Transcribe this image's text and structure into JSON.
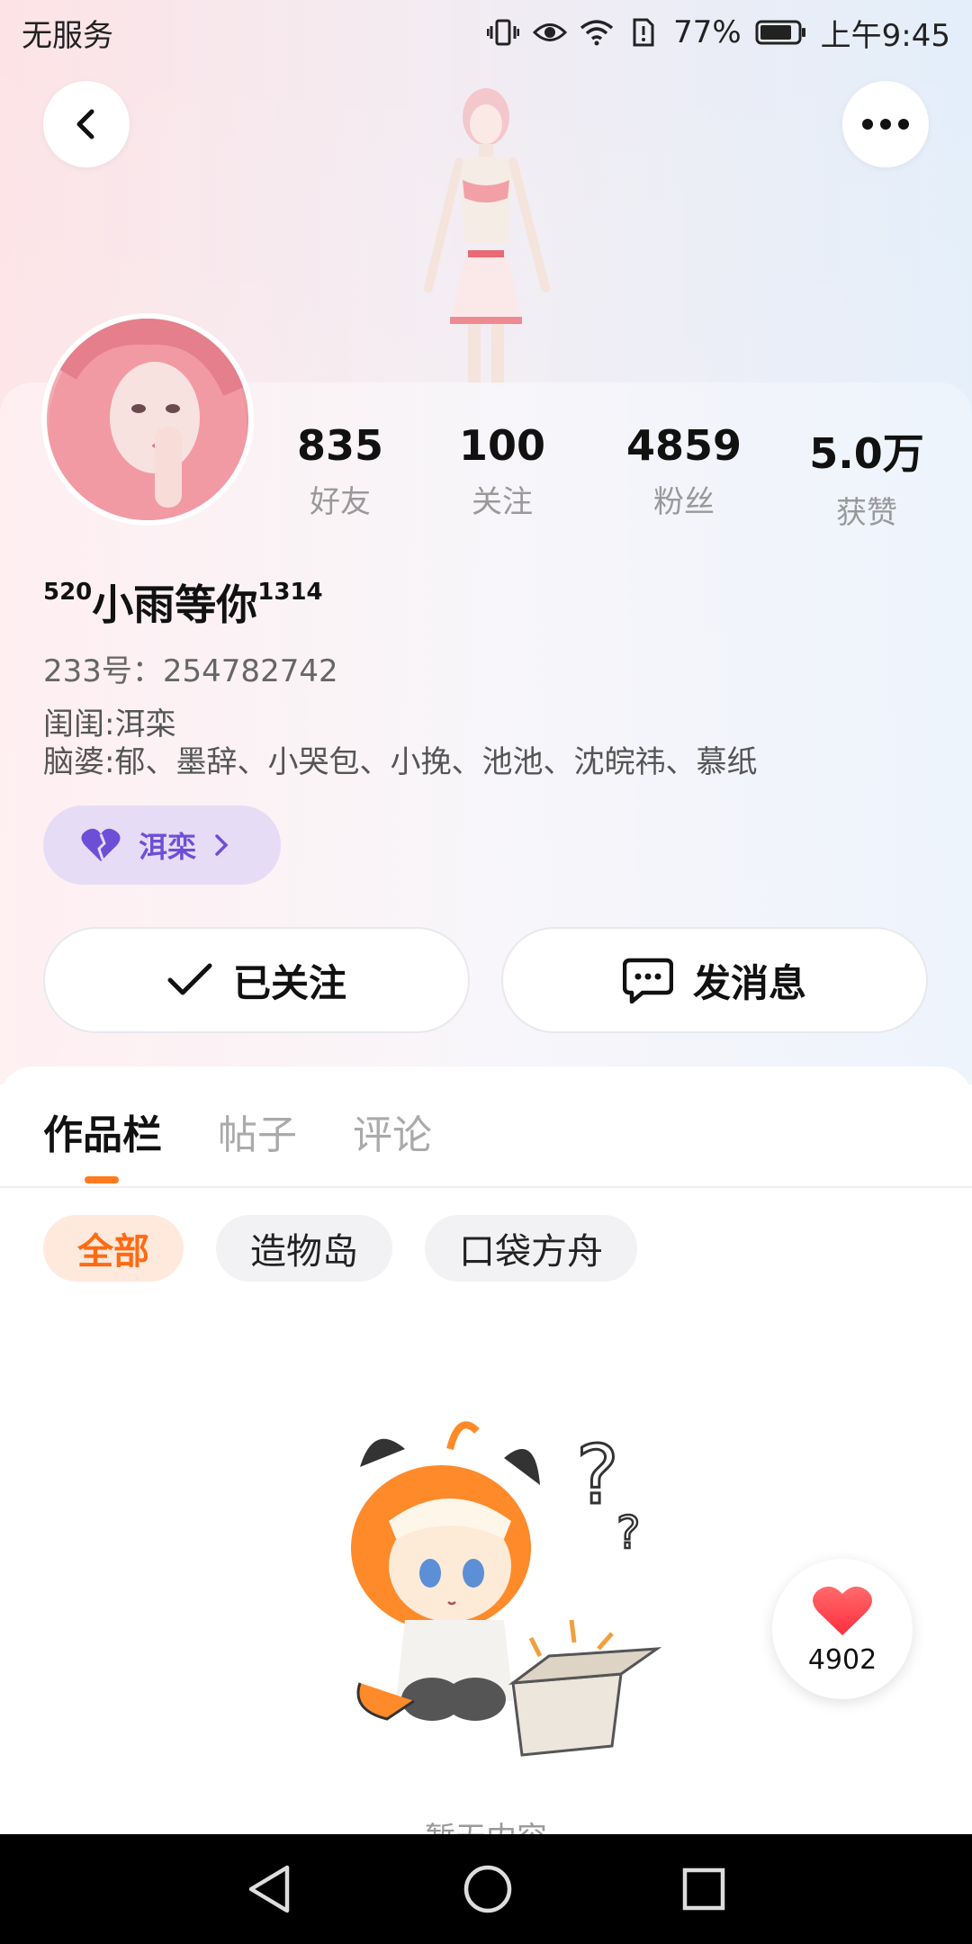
{
  "status_bar": {
    "carrier": "无服务",
    "battery_percent": "77%",
    "time": "上午9:45",
    "icons": [
      "vibrate-icon",
      "eye-icon",
      "wifi-icon",
      "sim-icon",
      "battery-icon"
    ]
  },
  "header": {
    "back_icon": "chevron-left-icon",
    "more_icon": "more-dots-icon"
  },
  "profile": {
    "username_prefix": "520",
    "username_main": "小雨等你",
    "username_suffix": "1314",
    "uid_label": "233号：",
    "uid_value": "254782742",
    "bio_line1": "闺闺:洱栾",
    "bio_line2": "脑婆:郁、墨辞、小哭包、小挽、池池、沈皖祎、慕纸",
    "tag_label": "洱栾",
    "stats": [
      {
        "value": "835",
        "label": "好友"
      },
      {
        "value": "100",
        "label": "关注"
      },
      {
        "value": "4859",
        "label": "粉丝"
      },
      {
        "value": "5.0万",
        "label": "获赞"
      }
    ]
  },
  "actions": {
    "follow_label": "已关注",
    "message_label": "发消息"
  },
  "tabs": [
    {
      "label": "作品栏",
      "active": true
    },
    {
      "label": "帖子",
      "active": false
    },
    {
      "label": "评论",
      "active": false
    }
  ],
  "filters": [
    {
      "label": "全部",
      "active": true
    },
    {
      "label": "造物岛",
      "active": false
    },
    {
      "label": "口袋方舟",
      "active": false
    }
  ],
  "empty_state": {
    "text": "暂无内容"
  },
  "like_fab": {
    "count": "4902"
  },
  "colors": {
    "accent_orange": "#ff7a1f",
    "tag_purple": "#6c4fd6",
    "heart_red": "#ff3b4a"
  }
}
